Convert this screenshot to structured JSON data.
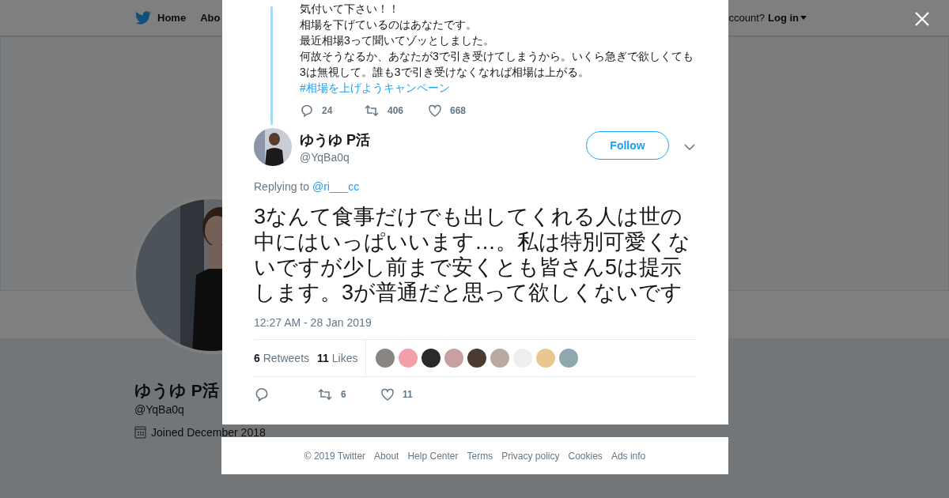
{
  "background_page": {
    "nav": {
      "home": "Home",
      "about_partial": "Abo",
      "account_partial": "ccount?",
      "login": "Log in"
    },
    "profile": {
      "name": "ゆうゆ P活",
      "handle": "@YqBa0q",
      "joined": "Joined December 2018"
    }
  },
  "modal": {
    "previous_tweet": {
      "lines": [
        "気付いて下さい！！",
        "相場を下げているのはあなたです。",
        "最近相場3って聞いてゾッとしました。",
        "何故そうなるか、あなたが3で引き受けてしまうから。いくら急ぎで欲しくても3は無視して。誰も3で引き受けなくなれば相場は上がる。"
      ],
      "hashtag": "#相場を上げようキャンペーン",
      "replies": "24",
      "retweets": "406",
      "likes": "668"
    },
    "tweet": {
      "name": "ゆうゆ P活",
      "handle": "@YqBa0q",
      "follow": "Follow",
      "replying_label": "Replying to",
      "replying_to": "@ri___cc",
      "text": "3なんて食事だけでも出してくれる人は世の中にはいっぱいいます…。私は特別可愛くないですが少し前まで安くとも皆さん5は提示します。3が普通だと思って欲しくないです",
      "timestamp": "12:27 AM - 28 Jan 2019",
      "retweet_count": "6",
      "retweet_label": "Retweets",
      "like_count": "11",
      "like_label": "Likes",
      "likers": [
        {
          "color": "#8a8580"
        },
        {
          "color": "#f2a0a8"
        },
        {
          "color": "#2a2a2a"
        },
        {
          "color": "#c9a0a0"
        },
        {
          "color": "#4a3a30"
        },
        {
          "color": "#b8aaa0"
        },
        {
          "color": "#eeeeee"
        },
        {
          "color": "#e8c890"
        },
        {
          "color": "#8fa8b0"
        }
      ],
      "action_retweets": "6",
      "action_likes": "11"
    }
  },
  "footer": {
    "links": [
      "© 2019 Twitter",
      "About",
      "Help Center",
      "Terms",
      "Privacy policy",
      "Cookies",
      "Ads info"
    ]
  }
}
